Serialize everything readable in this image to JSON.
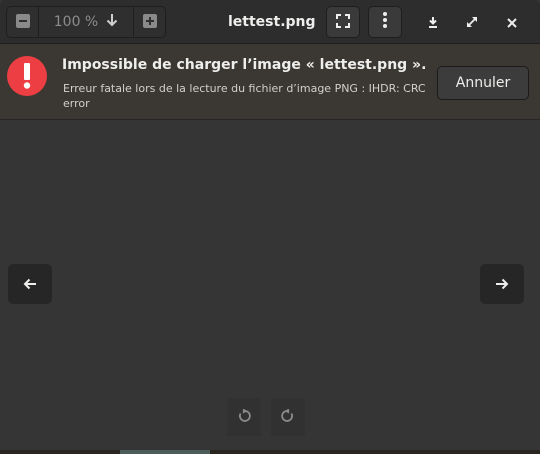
{
  "window": {
    "title": "lettest.png"
  },
  "toolbar": {
    "zoom_out": {
      "icon": "minus-icon"
    },
    "zoom_level": "100 %",
    "zoom_menu": {
      "icon": "chevron-down-icon"
    },
    "zoom_in": {
      "icon": "plus-icon"
    },
    "fullscreen": {
      "icon": "fullscreen-icon"
    },
    "menu": {
      "icon": "vertical-dots-icon"
    },
    "download": {
      "icon": "download-icon"
    },
    "maximize": {
      "icon": "maximize-icon"
    },
    "close": {
      "icon": "close-icon"
    }
  },
  "error": {
    "title": "Impossible de charger l’image « lettest.png ».",
    "message": "Erreur fatale lors de la lecture du fichier d’image PNG : IHDR: CRC error",
    "cancel_label": "Annuler",
    "icon": "error-icon",
    "icon_color": "#ed3f43"
  },
  "navigation": {
    "previous": {
      "icon": "arrow-left-icon"
    },
    "next": {
      "icon": "arrow-right-icon"
    }
  },
  "rotate": {
    "left": {
      "icon": "rotate-left-icon"
    },
    "right": {
      "icon": "rotate-right-icon"
    }
  }
}
